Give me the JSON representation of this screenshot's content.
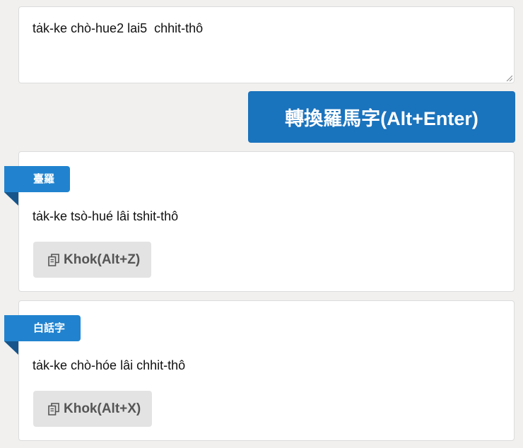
{
  "input": {
    "value": "tȧk-ke chò-hue2 lai5  chhit-thô"
  },
  "convert_button": {
    "label": "轉換羅馬字(Alt+Enter)"
  },
  "results": [
    {
      "label": "臺羅",
      "text": "tȧk-ke tsò-hué lâi tshit-thô",
      "copy_label": "Khok(Alt+Z)"
    },
    {
      "label": "白話字",
      "text": "tȧk-ke chò-hóe lâi chhit-thô",
      "copy_label": "Khok(Alt+X)"
    }
  ],
  "icons": {
    "copy": "copy-icon",
    "resize": "resize-grip-icon"
  },
  "colors": {
    "primary": "#1a73bd",
    "ribbon": "#2183cf",
    "ribbon_fold": "#15558b",
    "copy_button_bg": "#e3e3e3",
    "background": "#f1f0ee"
  }
}
